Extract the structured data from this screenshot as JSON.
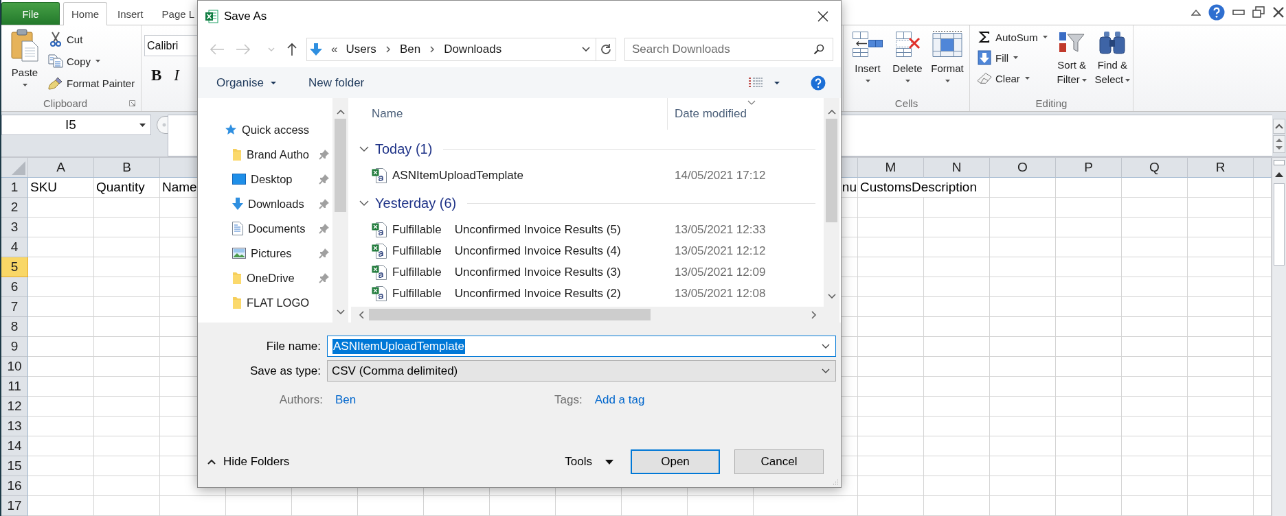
{
  "excel": {
    "tabs": [
      {
        "label": "File",
        "kind": "file",
        "selected": false
      },
      {
        "label": "Home",
        "kind": "tab",
        "selected": true
      },
      {
        "label": "Insert",
        "kind": "tab",
        "selected": false
      },
      {
        "label": "Page L",
        "kind": "tab",
        "selected": false
      }
    ],
    "clipboard": {
      "paste": "Paste",
      "actions": [
        {
          "label": "Cut",
          "dropdown": false
        },
        {
          "label": "Copy",
          "dropdown": true
        },
        {
          "label": "Format Painter",
          "dropdown": false
        }
      ],
      "group_label": "Clipboard"
    },
    "font": {
      "font_name": "Calibri",
      "styles": [
        "B",
        "I"
      ]
    },
    "cells": {
      "buttons": [
        "Insert",
        "Delete",
        "Format"
      ],
      "group_label": "Cells"
    },
    "editing": {
      "actions": [
        {
          "label": "AutoSum",
          "dropdown": true
        },
        {
          "label": "Fill",
          "dropdown": true
        },
        {
          "label": "Clear",
          "dropdown": true
        }
      ],
      "buttons": [
        "Sort & Filter",
        "Find & Select"
      ],
      "group_label": "Editing"
    },
    "name_box": "I5",
    "sheet": {
      "columns": [
        "A",
        "B"
      ],
      "columns_right": [
        "M",
        "N",
        "O",
        "P",
        "Q",
        "R"
      ],
      "rows": [
        {
          "label": "1",
          "selected": false,
          "cells": [
            "SKU",
            "Quantity",
            "Name"
          ],
          "tail": "nu",
          "cells_right": [
            "CustomsDescription"
          ]
        },
        {
          "label": "2",
          "selected": false
        },
        {
          "label": "3",
          "selected": false
        },
        {
          "label": "4",
          "selected": false
        },
        {
          "label": "5",
          "selected": true
        },
        {
          "label": "6",
          "selected": false
        },
        {
          "label": "7",
          "selected": false
        },
        {
          "label": "8",
          "selected": false
        },
        {
          "label": "9",
          "selected": false
        },
        {
          "label": "10",
          "selected": false
        },
        {
          "label": "11",
          "selected": false
        },
        {
          "label": "12",
          "selected": false
        },
        {
          "label": "13",
          "selected": false
        },
        {
          "label": "14",
          "selected": false
        },
        {
          "label": "15",
          "selected": false
        },
        {
          "label": "16",
          "selected": false
        },
        {
          "label": "17",
          "selected": false
        }
      ]
    }
  },
  "dialog": {
    "title": "Save As",
    "nav_buttons": [
      {
        "kind": "back",
        "disabled": true
      },
      {
        "kind": "forward",
        "disabled": true
      },
      {
        "kind": "recent",
        "disabled": true
      },
      {
        "kind": "up",
        "disabled": false
      }
    ],
    "address": {
      "overflow": "«",
      "path": [
        "Users",
        "Ben",
        "Downloads"
      ]
    },
    "search": {
      "placeholder": "Search Downloads"
    },
    "toolbar": {
      "organise": "Organise",
      "new_folder": "New folder"
    },
    "nav_pane": [
      {
        "label": "Quick access",
        "kind": "star",
        "pinned": false,
        "children": [
          {
            "label": "Brand Autho",
            "kind": "folder",
            "pinned": true
          },
          {
            "label": "Desktop",
            "kind": "desktop",
            "pinned": true
          },
          {
            "label": "Downloads",
            "kind": "download",
            "pinned": true
          },
          {
            "label": "Documents",
            "kind": "document",
            "pinned": true
          },
          {
            "label": "Pictures",
            "kind": "picture",
            "pinned": true
          },
          {
            "label": "OneDrive",
            "kind": "folder",
            "pinned": true
          },
          {
            "label": "FLAT LOGO",
            "kind": "folder",
            "pinned": false
          }
        ]
      }
    ],
    "list": {
      "columns": [
        {
          "label": "Name",
          "sorted": false
        },
        {
          "label": "Date modified",
          "sorted": true
        }
      ],
      "groups": [
        {
          "label": "Today (1)",
          "expanded": true,
          "files": [
            {
              "name": "ASNItemUploadTemplate",
              "modified": "14/05/2021 17:12"
            }
          ]
        },
        {
          "label": "Yesterday (6)",
          "expanded": true,
          "files": [
            {
              "name": "Fulfillable    Unconfirmed Invoice Results (5)",
              "modified": "13/05/2021 12:33"
            },
            {
              "name": "Fulfillable    Unconfirmed Invoice Results (4)",
              "modified": "13/05/2021 12:12"
            },
            {
              "name": "Fulfillable    Unconfirmed Invoice Results (3)",
              "modified": "13/05/2021 12:09"
            },
            {
              "name": "Fulfillable    Unconfirmed Invoice Results (2)",
              "modified": "13/05/2021 12:08"
            }
          ]
        }
      ]
    },
    "file_name": {
      "label": "File name:",
      "value": "ASNItemUploadTemplate",
      "selected": true
    },
    "save_as_type": {
      "label": "Save as type:",
      "value": "CSV (Comma delimited)"
    },
    "authors": {
      "label": "Authors:",
      "value": "Ben"
    },
    "tags": {
      "label": "Tags:",
      "value": "Add a tag"
    },
    "hide_folders": "Hide Folders",
    "tools": "Tools",
    "buttons": [
      {
        "label": "Open",
        "default": true
      },
      {
        "label": "Cancel",
        "default": false
      }
    ]
  }
}
